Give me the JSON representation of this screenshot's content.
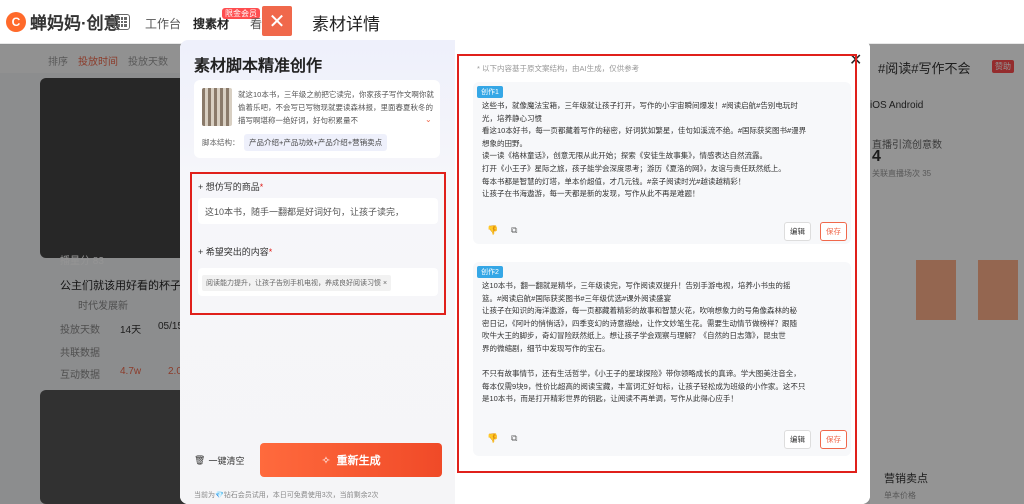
{
  "app": {
    "brand": "蝉妈妈·创意",
    "nav_workbench": "工作台",
    "nav_search": "搜素材",
    "nav_badge": "限金会员",
    "nav_third": "看",
    "page_title": "素材详情"
  },
  "background": {
    "filters": [
      "排序",
      "投放时间",
      "投放天数"
    ],
    "card_views": "播量分 83",
    "card_title": "公主们就该用好看的杯子！",
    "card_author": "时代发展新",
    "card_stats": [
      "投放天数",
      "14天",
      "05/15"
    ],
    "card_metric_labels": [
      "共联数据",
      "互动数据"
    ],
    "card_metric_values": [
      "4.7w",
      "2.0"
    ],
    "right_tag": "#阅读#写作不会",
    "right_tag_badge": "赞助",
    "right_os": "iOS  Android",
    "right_stat_label": "直播引流创意数",
    "right_stat_value": "4",
    "right_stat_sub": "关联直播场次 35",
    "right_bottom_title": "营销卖点",
    "right_bottom_sub": "单本价格"
  },
  "modal": {
    "title": "素材脚本精准创作",
    "reference_text": "就这10本书，三年级之前把它读完，你家孩子写作文啊你就偷着乐吧，不会写已写物现就要读森林报，里面春夏秋冬的描写啊堪称一绝好词，好句积累量不",
    "structure_label": "脚本结构：",
    "structure_value": "产品介绍+产品功效+产品介绍+营销卖点",
    "product_label": "想仿写的商品",
    "product_value": "这10本书，随手一翻都是好词好句，让孩子读完，",
    "highlight_label": "希望突出的内容",
    "highlight_tag": "阅读能力提升，让孩子告别手机电视，养成良好阅读习惯",
    "clear_label": "一键清空",
    "regen_label": "重新生成",
    "footnote": "当前为💎钻石会员试用，本日可免费使用3次，当前剩余2次"
  },
  "results": {
    "hint": "* 以下内容基于原文案结构，由AI生成，仅供参考",
    "edit_label": "编辑",
    "save_label": "保存",
    "items": [
      {
        "badge": "创作1",
        "lines": [
          "这些书，就像魔法宝箱，三年级就让孩子打开，写作的小宇宙瞬间爆发！#阅读启航#告别电玩时",
          "光，培养静心习惯",
          "看这10本好书，每一页都藏着写作的秘密，好词犹如繁星，佳句如溪流不绝。#国际获奖图书#漫界",
          "想象的田野。",
          "读一读《格林童话》，创意无限从此开始；探索《安徒生故事集》，情感表达自然流露。",
          "打开《小王子》星际之旅，孩子能学会深度思考；游历《夏洛的网》，友谊与责任跃然纸上。",
          "每本书都是智慧的灯塔，单本价超值，才几元钱。#亲子阅读时光#越读越精彩！",
          "让孩子在书海遨游，每一天都是新的发现，写作从此不再是难题！"
        ]
      },
      {
        "badge": "创作2",
        "lines": [
          "这10本书，翻一翻就是精华，三年级读完，写作阅读双提升！告别手游电视，培养小书虫的摇",
          "篮。#阅读启航#国际获奖图书#三年级优选#课外阅读盛宴",
          "让孩子在知识的海洋遨游，每一页都藏着精彩的故事和智慧火花，吹响想象力的号角像森林的秘",
          "密日记，《阿叶的悄悄话》，四季变幻的诗意描绘，让作文妙笔生花。需要生动情节做榜样？跟随",
          "吹牛大王的脚步，奇幻冒险跃然纸上。想让孩子学会观察与理解？《自然的日志簿》，昆虫世",
          "界的微缩剧，细节中发现写作的宝石。",
          "",
          "不只有故事情节，还有生活哲学，《小王子的星球探险》带你领略成长的真谛。学大图美注音全，",
          "每本仅需9块9，性价比超高的阅读宝藏，丰富词汇好句标，让孩子轻松成为班级的小作家。这不只",
          "是10本书，而是打开精彩世界的钥匙，让阅读不再单调，写作从此得心应手！"
        ]
      }
    ]
  },
  "colors": {
    "accent": "#f0684b",
    "badge": "#35a7e6",
    "highlight_border": "#e0201b"
  }
}
